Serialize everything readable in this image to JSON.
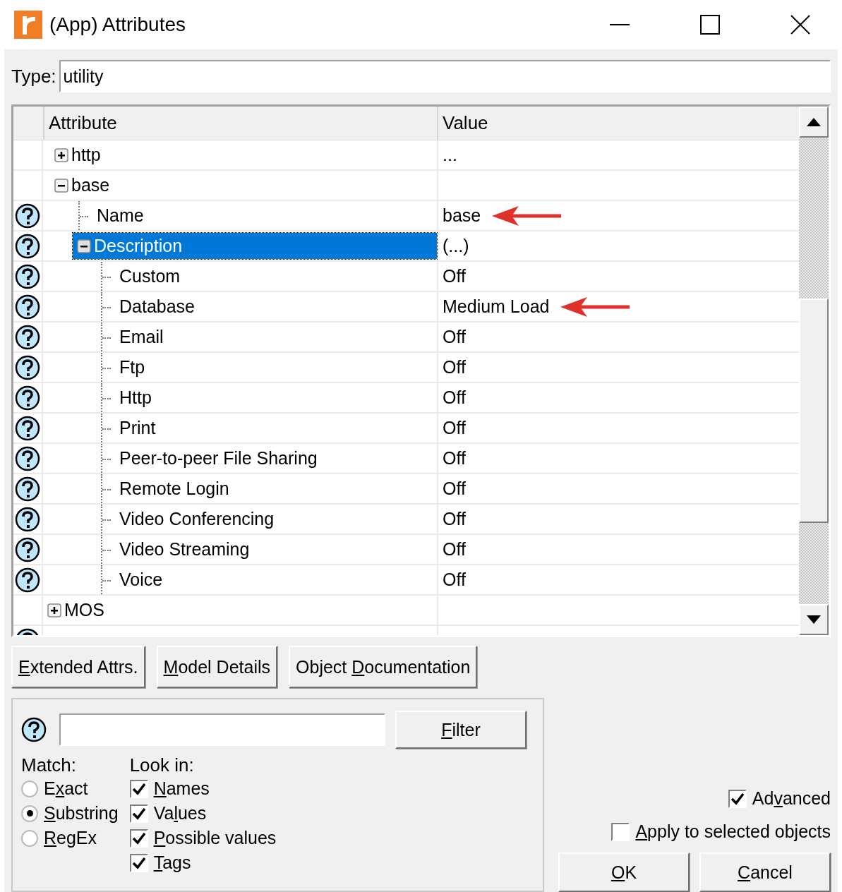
{
  "window": {
    "title": "(App) Attributes"
  },
  "type_field": {
    "label": "Type:",
    "value": "utility"
  },
  "table": {
    "columns": [
      "Attribute",
      "Value"
    ],
    "tree": [
      {
        "children": [
          {
            "label": "http",
            "value": "...",
            "help": false,
            "expanded": false,
            "selected": false,
            "marked": false
          },
          {
            "label": "base",
            "help": false,
            "expanded": true,
            "selected": false,
            "marked": false,
            "children": [
              {
                "label": "Name",
                "value": "base",
                "help": true,
                "selected": false,
                "marked": true
              },
              {
                "label": "Description",
                "value": "(...)",
                "help": true,
                "expanded": true,
                "selected": true,
                "marked": false,
                "children": [
                  {
                    "label": "Custom",
                    "value": "Off",
                    "help": true,
                    "selected": false,
                    "marked": false
                  },
                  {
                    "label": "Database",
                    "value": "Medium Load",
                    "help": true,
                    "selected": false,
                    "marked": true
                  },
                  {
                    "label": "Email",
                    "value": "Off",
                    "help": true,
                    "selected": false,
                    "marked": false
                  },
                  {
                    "label": "Ftp",
                    "value": "Off",
                    "help": true,
                    "selected": false,
                    "marked": false
                  },
                  {
                    "label": "Http",
                    "value": "Off",
                    "help": true,
                    "selected": false,
                    "marked": false
                  },
                  {
                    "label": "Print",
                    "value": "Off",
                    "help": true,
                    "selected": false,
                    "marked": false
                  },
                  {
                    "label": "Peer-to-peer File Sharing",
                    "value": "Off",
                    "help": true,
                    "selected": false,
                    "marked": false
                  },
                  {
                    "label": "Remote Login",
                    "value": "Off",
                    "help": true,
                    "selected": false,
                    "marked": false
                  },
                  {
                    "label": "Video Conferencing",
                    "value": "Off",
                    "help": true,
                    "selected": false,
                    "marked": false
                  },
                  {
                    "label": "Video Streaming",
                    "value": "Off",
                    "help": true,
                    "selected": false,
                    "marked": false
                  },
                  {
                    "label": "Voice",
                    "value": "Off",
                    "help": true,
                    "selected": false,
                    "marked": false
                  }
                ]
              }
            ]
          }
        ]
      },
      {
        "label": "MOS",
        "help": false,
        "expanded": false,
        "selected": false,
        "marked": false
      },
      {
        "help": true
      }
    ]
  },
  "buttons": [
    {
      "key": "E",
      "post": "xtended Attrs."
    },
    {
      "key": "M",
      "post": "odel Details"
    },
    {
      "pre": "Object ",
      "key": "D",
      "post": "ocumentation"
    }
  ],
  "filter": {
    "button": {
      "key": "F",
      "post": "ilter"
    },
    "match": {
      "label": "Match:",
      "options": [
        {
          "pre": "E",
          "key": "x",
          "post": "act",
          "selected": false
        },
        {
          "key": "S",
          "post": "ubstring",
          "selected": true
        },
        {
          "key": "R",
          "post": "egEx",
          "selected": false
        }
      ]
    },
    "look_in": {
      "label": "Look in:",
      "options": [
        {
          "key": "N",
          "post": "ames",
          "checked": true
        },
        {
          "pre": "Va",
          "key": "l",
          "post": "ues",
          "checked": true
        },
        {
          "key": "P",
          "post": "ossible values",
          "checked": true
        },
        {
          "key": "T",
          "post": "ags",
          "checked": true
        }
      ]
    }
  },
  "options": [
    {
      "pre": "Ad",
      "key": "v",
      "post": "anced",
      "checked": true
    },
    {
      "key": "A",
      "post": "pply to selected objects",
      "checked": false
    }
  ],
  "dialog_buttons": [
    {
      "key": "O",
      "post": "K"
    },
    {
      "key": "C",
      "post": "ancel"
    }
  ]
}
